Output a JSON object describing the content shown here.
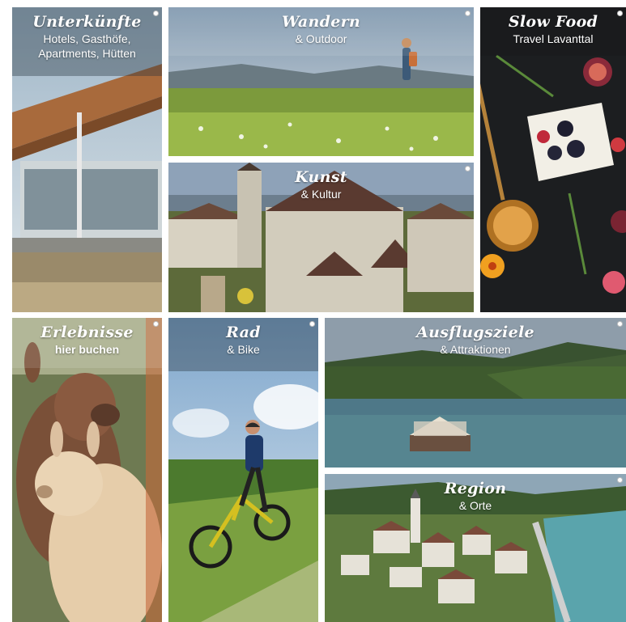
{
  "tiles": {
    "unterkuenfte": {
      "title": "Unterkünfte",
      "subtitle": "Hotels, Gasthöfe, Apartments, Hütten"
    },
    "wandern": {
      "title": "Wandern",
      "subtitle": "& Outdoor"
    },
    "slowfood": {
      "title": "Slow Food",
      "subtitle": "Travel Lavanttal"
    },
    "kunst": {
      "title": "Kunst",
      "subtitle": "& Kultur"
    },
    "erlebnisse": {
      "title": "Erlebnisse",
      "subtitle": "hier buchen"
    },
    "rad": {
      "title": "Rad",
      "subtitle": "& Bike"
    },
    "ausflugsziele": {
      "title": "Ausflugsziele",
      "subtitle": "& Attraktionen"
    },
    "region": {
      "title": "Region",
      "subtitle": "& Orte"
    }
  },
  "colors": {
    "background": "#ffffff",
    "band_overlay": "#28343e",
    "title_text": "#ffffff"
  }
}
